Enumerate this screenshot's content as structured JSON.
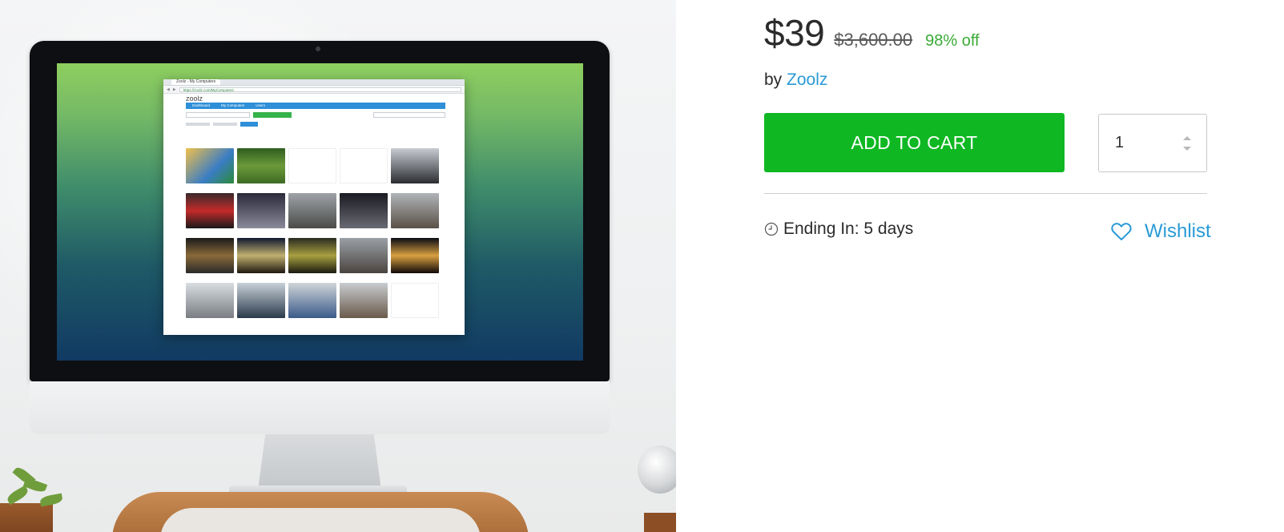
{
  "pricing": {
    "current_price": "$39",
    "original_price": "$3,600.00",
    "discount": "98% off"
  },
  "vendor": {
    "prefix": "by",
    "name": "Zoolz"
  },
  "cart": {
    "add_to_cart_label": "ADD TO CART",
    "quantity": "1"
  },
  "sale": {
    "ending_label": "Ending In: 5 days",
    "clock_icon": "clock-icon"
  },
  "wishlist": {
    "label": "Wishlist",
    "icon": "heart-icon"
  },
  "colors": {
    "add_to_cart_bg": "#0fb822",
    "discount_text": "#3aaa35",
    "link": "#2a9ad6"
  },
  "product_image": {
    "inner_browser": {
      "tab_label": "Zoolz - My Computers",
      "url": "https://zoolz.com/MyComputers",
      "brand": "zoolz",
      "nav_items": [
        "Dashboard",
        "My Computers",
        "Users"
      ]
    }
  }
}
